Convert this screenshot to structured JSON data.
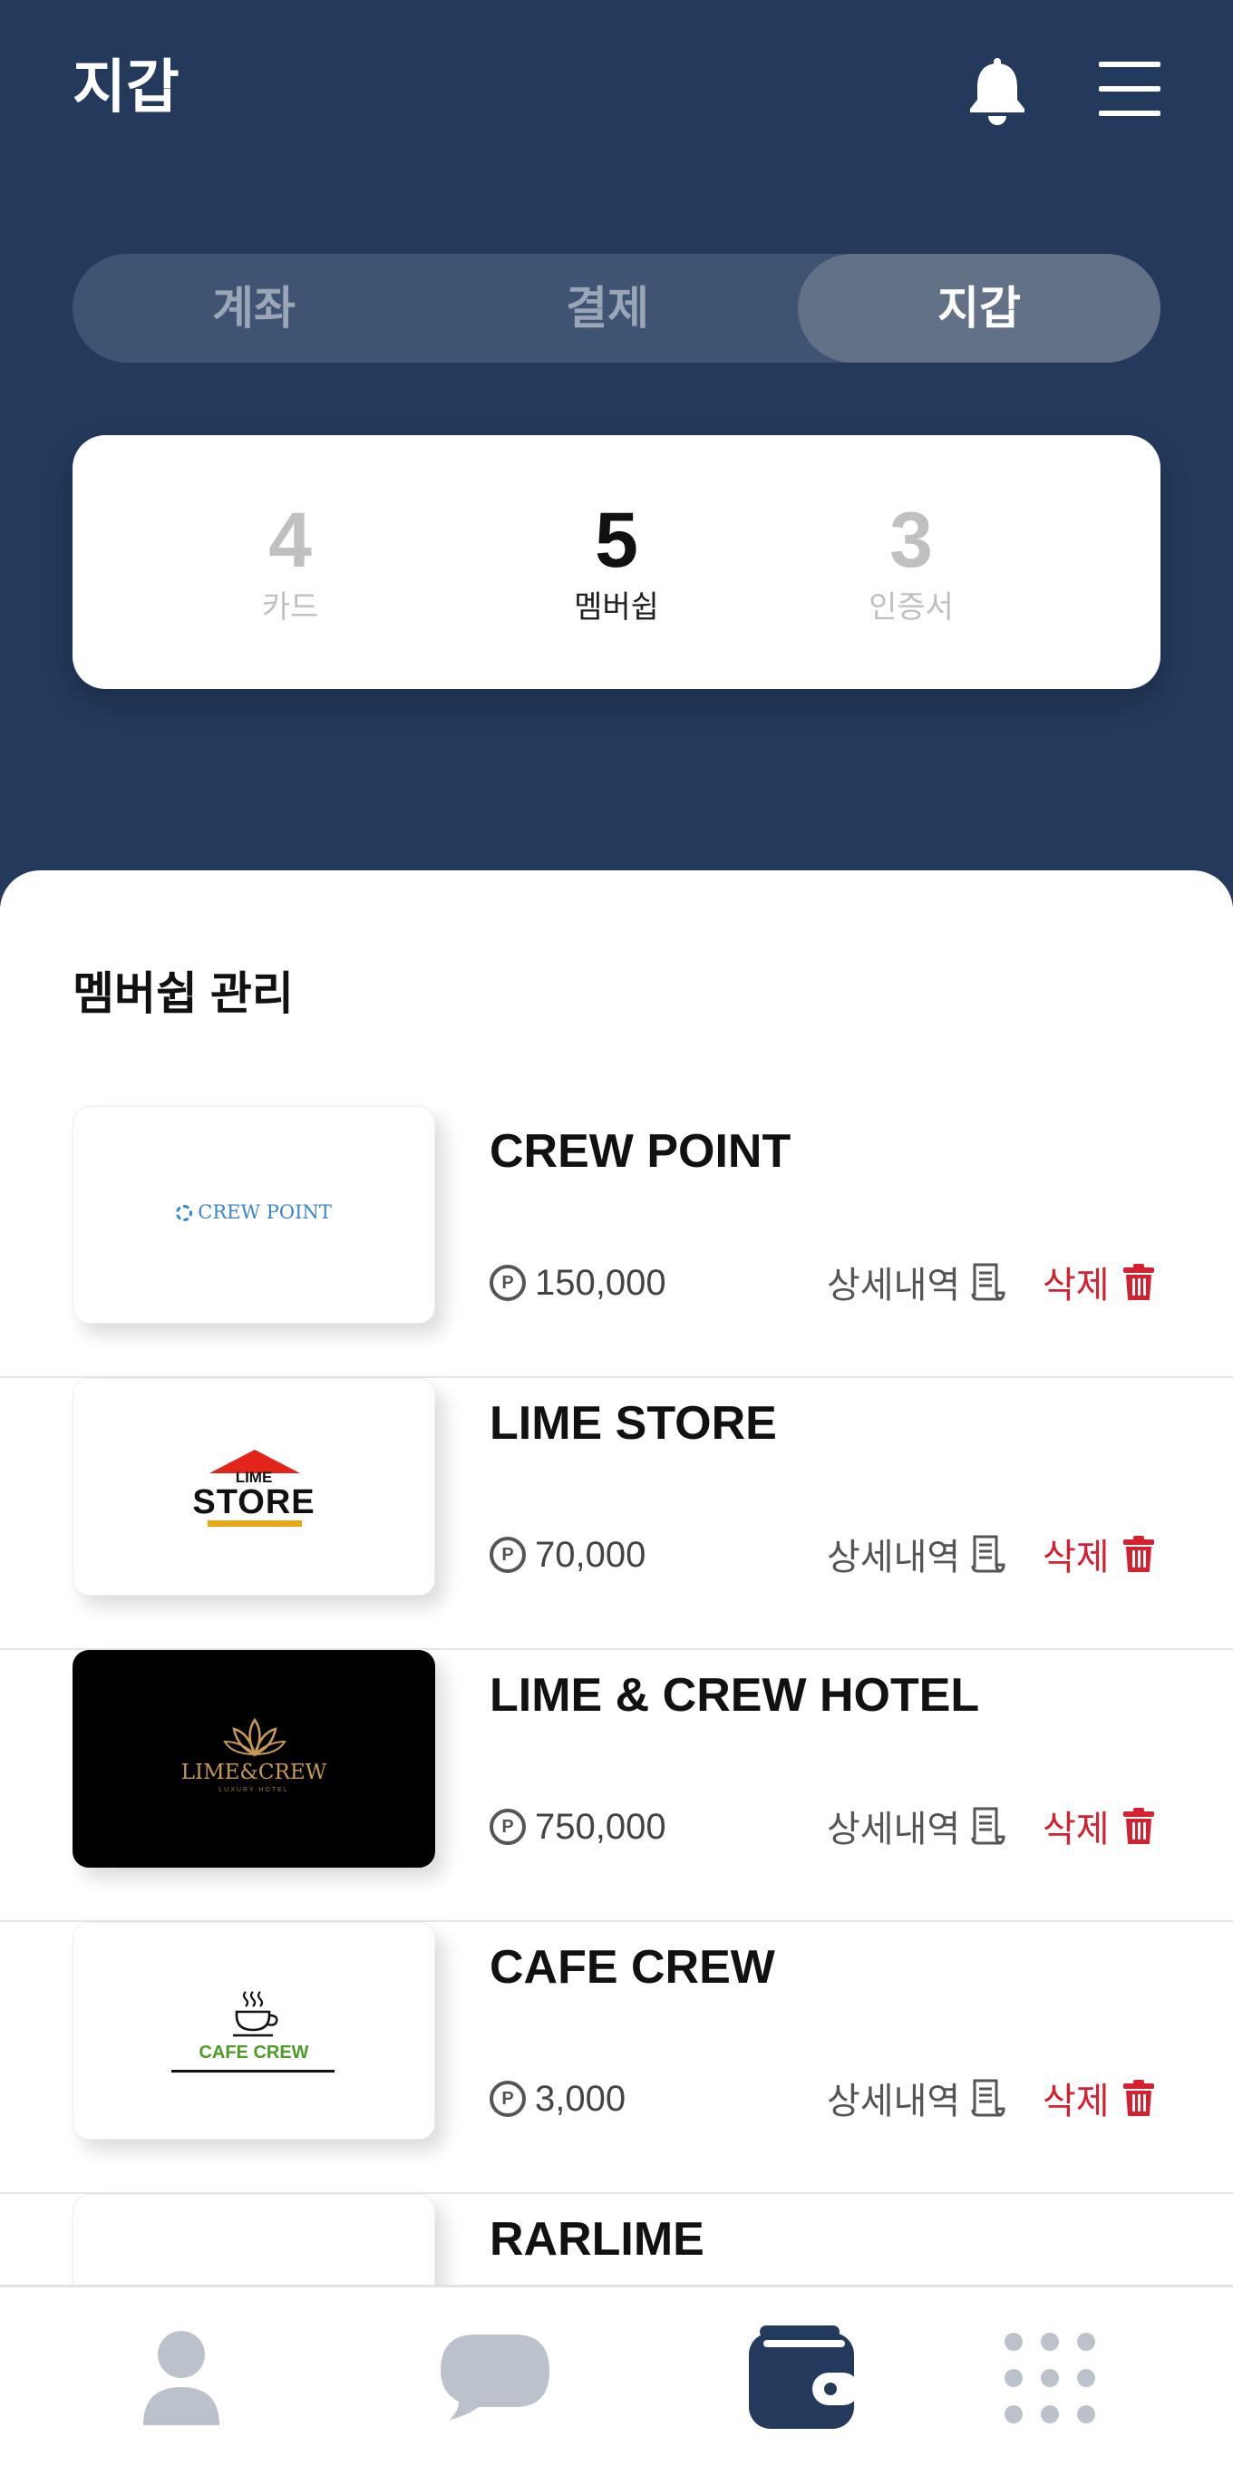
{
  "header": {
    "title": "지갑"
  },
  "tabs": [
    {
      "label": "계좌",
      "active": false
    },
    {
      "label": "결제",
      "active": false
    },
    {
      "label": "지갑",
      "active": true
    }
  ],
  "stats": [
    {
      "count": "4",
      "label": "카드",
      "active": false
    },
    {
      "count": "5",
      "label": "멤버쉽",
      "active": true
    },
    {
      "count": "3",
      "label": "인증서",
      "active": false
    }
  ],
  "section": {
    "title": "멤버쉽 관리"
  },
  "memberships": [
    {
      "name": "CREW POINT",
      "points": "150,000",
      "logo_text": "CREW POINT"
    },
    {
      "name": "LIME STORE",
      "points": "70,000",
      "logo_text_top": "LIME",
      "logo_text_bottom": "STORE"
    },
    {
      "name": "LIME & CREW HOTEL",
      "points": "750,000",
      "logo_text": "LIME&CREW",
      "logo_subtext": "LUXURY HOTEL"
    },
    {
      "name": "CAFE CREW",
      "points": "3,000",
      "logo_text": "CAFE CREW"
    },
    {
      "name": "RARLIME"
    }
  ],
  "actions": {
    "detail": "상세내역",
    "delete": "삭제"
  },
  "points_symbol": "P",
  "colors": {
    "header_bg": "#233a5c",
    "segment_bg": "#3f5472",
    "segment_active": "#637187",
    "delete_red": "#d32130",
    "nav_active": "#233a5c",
    "nav_inactive": "#bcc2cc"
  },
  "icons": {
    "header": [
      "bell-icon",
      "menu-icon"
    ],
    "row": [
      "point-icon",
      "receipt-icon",
      "trash-icon"
    ],
    "nav": [
      "person-icon",
      "chat-bubble-icon",
      "wallet-icon",
      "grid-dots-icon"
    ]
  },
  "bottom_nav": {
    "active_index": 2
  }
}
